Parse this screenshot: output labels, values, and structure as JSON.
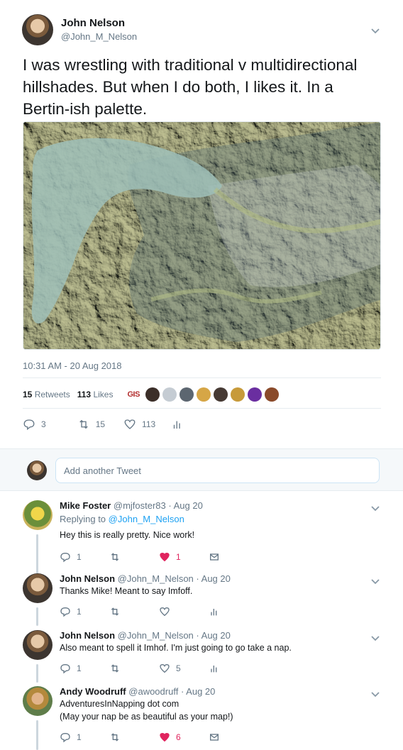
{
  "tweet": {
    "author_name": "John Nelson",
    "author_handle": "@John_M_Nelson",
    "text": "I was wrestling with traditional v multidirectional hillshades. But when I do both, I likes it. In a Bertin-ish palette.",
    "timestamp": "10:31 AM - 20 Aug 2018",
    "retweets_count": "15",
    "retweets_label": "Retweets",
    "likes_count": "113",
    "likes_label": "Likes",
    "liker_badge": "GIS",
    "actions": {
      "replies": "3",
      "retweets": "15",
      "likes": "113"
    }
  },
  "reply_box": {
    "placeholder": "Add another Tweet"
  },
  "replies": [
    {
      "name": "Mike Foster",
      "handle": "@mjfoster83",
      "date": "· Aug 20",
      "replying_prefix": "Replying to",
      "replying_to": "@John_M_Nelson",
      "lines": [
        "Hey this is really pretty. Nice work!"
      ],
      "reply_count": "1",
      "retweet_count": "",
      "like_count": "1",
      "liked": true
    },
    {
      "name": "John Nelson",
      "handle": "@John_M_Nelson",
      "date": "· Aug 20",
      "lines": [
        "Thanks Mike! Meant to say Imfoff."
      ],
      "reply_count": "1",
      "retweet_count": "",
      "like_count": "",
      "liked": false
    },
    {
      "name": "John Nelson",
      "handle": "@John_M_Nelson",
      "date": "· Aug 20",
      "lines": [
        "Also meant to spell it Imhof. I'm just going to go take a nap."
      ],
      "reply_count": "1",
      "retweet_count": "",
      "like_count": "5",
      "liked": false
    },
    {
      "name": "Andy Woodruff",
      "handle": "@awoodruff",
      "date": "· Aug 20",
      "lines": [
        "AdventuresInNapping dot com",
        "(May your nap be as beautiful as your map!)"
      ],
      "reply_count": "1",
      "retweet_count": "",
      "like_count": "6",
      "liked": true
    }
  ],
  "colors": {
    "accent": "#1da1f2",
    "like": "#e0245e",
    "muted": "#657786"
  },
  "icons": [
    "chevron-down-icon",
    "reply-icon",
    "retweet-icon",
    "heart-icon",
    "analytics-icon",
    "message-icon"
  ]
}
